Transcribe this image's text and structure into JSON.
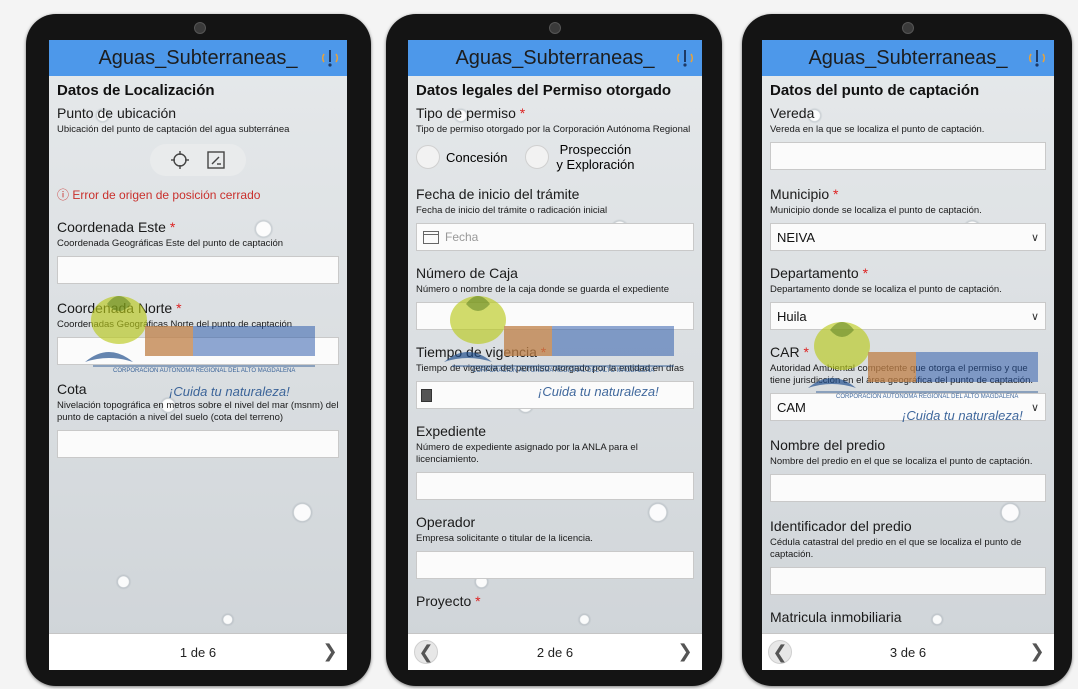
{
  "app": {
    "title": "Aguas_Subterraneas_"
  },
  "colors": {
    "header": "#4d98ea",
    "error": "#c9302c",
    "required": "#dd2222"
  },
  "watermark": {
    "brand": "cam",
    "subtitle": "CORPORACIÓN AUTÓNOMA REGIONAL DEL ALTO MAGDALENA",
    "slogan": "¡Cuida tu naturaleza!"
  },
  "screen1": {
    "section": "Datos de Localización",
    "punto": {
      "label": "Punto de ubicación",
      "help": "Ubicación del punto de captación del agua subterránea"
    },
    "error": "ⓘ Error de origen de posición cerrado",
    "este": {
      "label": "Coordenada Este",
      "help": "Coordenada Geográficas Este del punto de captación"
    },
    "norte": {
      "label": "Coordenada Norte",
      "help": "Coordenadas Geográficas Norte del punto de captación"
    },
    "cota": {
      "label": "Cota",
      "help": "Nivelación topográfica en metros sobre el nivel del mar (msnm) del punto de captación a nivel del suelo (cota del terreno)"
    },
    "page": "1 de 6"
  },
  "screen2": {
    "section": "Datos legales del Permiso otorgado",
    "tipo": {
      "label": "Tipo de permiso",
      "help": "Tipo de permiso otorgado por la Corporación Autónoma Regional"
    },
    "options": [
      "Concesión",
      "Prospección y Exploración"
    ],
    "fecha": {
      "label": "Fecha de inicio del trámite",
      "help": "Fecha de inicio del trámite o radicación inicial",
      "placeholder": "Fecha"
    },
    "caja": {
      "label": "Número de Caja",
      "help": "Número o nombre de la caja donde se guarda el expediente"
    },
    "vigencia": {
      "label": "Tiempo de vigencia",
      "help": "Tiempo de vigencia del permiso otorgado por la entidad en días"
    },
    "expediente": {
      "label": "Expediente",
      "help": "Número de expediente asignado por la ANLA para el licenciamiento."
    },
    "operador": {
      "label": "Operador",
      "help": "Empresa solicitante o titular de la licencia."
    },
    "proyecto": {
      "label": "Proyecto"
    },
    "page": "2 de 6"
  },
  "screen3": {
    "section": "Datos del punto de captación",
    "vereda": {
      "label": "Vereda",
      "help": "Vereda en la que se localiza el punto de captación."
    },
    "municipio": {
      "label": "Municipio",
      "help": "Municipio donde se localiza el punto de captación.",
      "value": "NEIVA"
    },
    "departamento": {
      "label": "Departamento",
      "help": "Departamento donde se localiza el punto de captación.",
      "value": "Huila"
    },
    "car": {
      "label": "CAR",
      "help": "Autoridad Ambiental competente que otorga el permiso y que tiene jurisdicción en el área geográfica del punto de captación.",
      "value": "CAM"
    },
    "predio": {
      "label": "Nombre del predio",
      "help": "Nombre del predio en el que se localiza el punto de captación."
    },
    "identificador": {
      "label": "Identificador del predio",
      "help": "Cédula catastral del predio en el que se localiza el punto de captación."
    },
    "matricula": {
      "label": "Matricula inmobiliaria"
    },
    "page": "3 de 6"
  }
}
